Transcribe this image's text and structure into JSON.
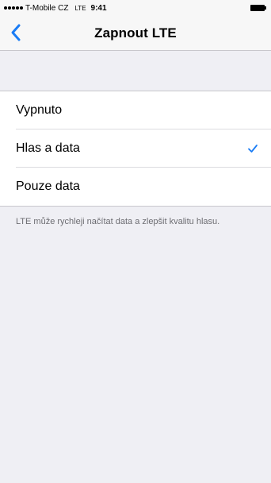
{
  "status_bar": {
    "carrier": "T-Mobile CZ",
    "network": "LTE",
    "time": "9:41",
    "signal_bars": 5,
    "battery_icon": "battery-icon"
  },
  "nav_bar": {
    "title": "Zapnout LTE",
    "back_icon": "chevron-left-icon",
    "accent_color": "#1a7cf5"
  },
  "options": [
    {
      "label": "Vypnuto",
      "selected": false
    },
    {
      "label": "Hlas a data",
      "selected": true
    },
    {
      "label": "Pouze data",
      "selected": false
    }
  ],
  "footer_note": "LTE může rychleji načítat data a zlepšit kvalitu hlasu.",
  "colors": {
    "background": "#efeff4",
    "checkmark": "#1a7cf5"
  }
}
